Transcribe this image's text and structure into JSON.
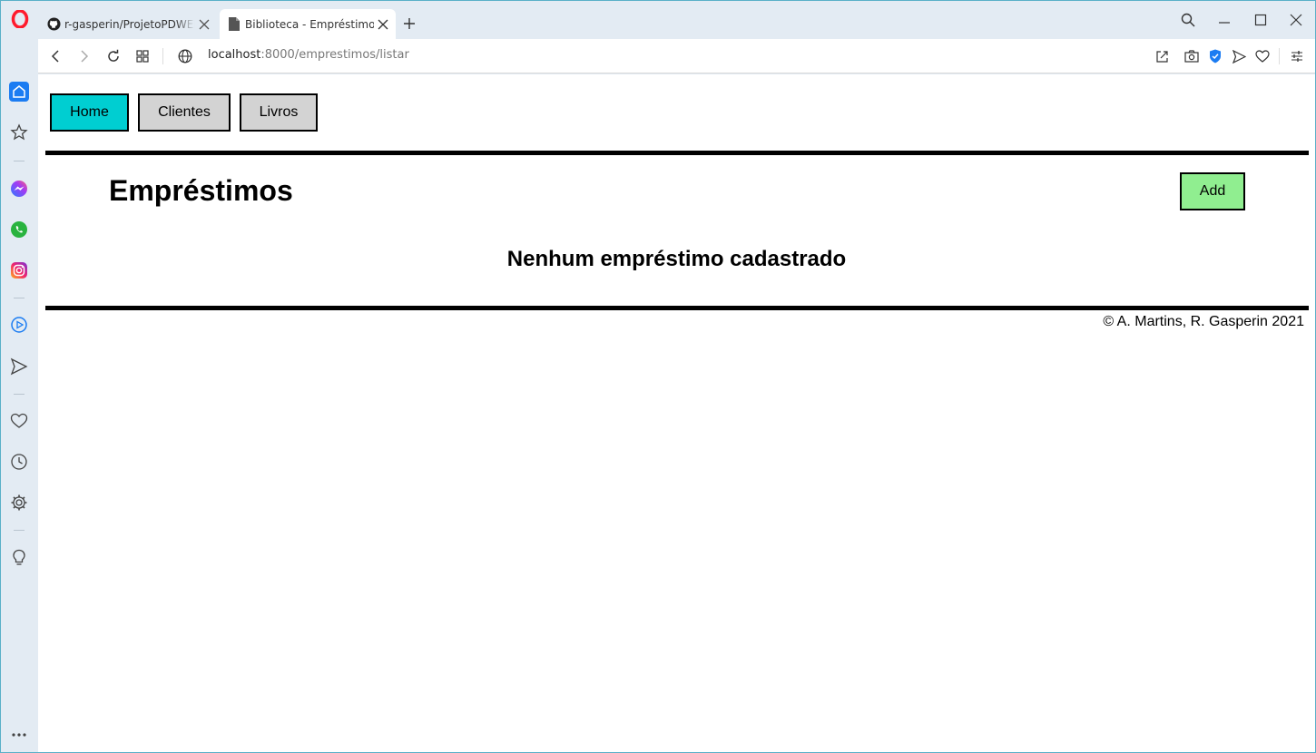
{
  "browser": {
    "tabs": [
      {
        "title": "r-gasperin/ProjetoPDWEL:",
        "icon": "github-icon"
      },
      {
        "title": "Biblioteca - Empréstimos",
        "icon": "document-icon"
      }
    ],
    "url_host": "localhost",
    "url_path": ":8000/emprestimos/listar"
  },
  "nav": {
    "home": "Home",
    "clientes": "Clientes",
    "livros": "Livros"
  },
  "main": {
    "title": "Empréstimos",
    "add_label": "Add",
    "empty_message": "Nenhum empréstimo cadastrado"
  },
  "footer": {
    "copyright": "© A. Martins, R. Gasperin 2021"
  },
  "colors": {
    "home_button": "#00ced1",
    "nav_button": "#d3d3d3",
    "add_button": "#90ee90",
    "opera_red": "#ff1b2d"
  }
}
